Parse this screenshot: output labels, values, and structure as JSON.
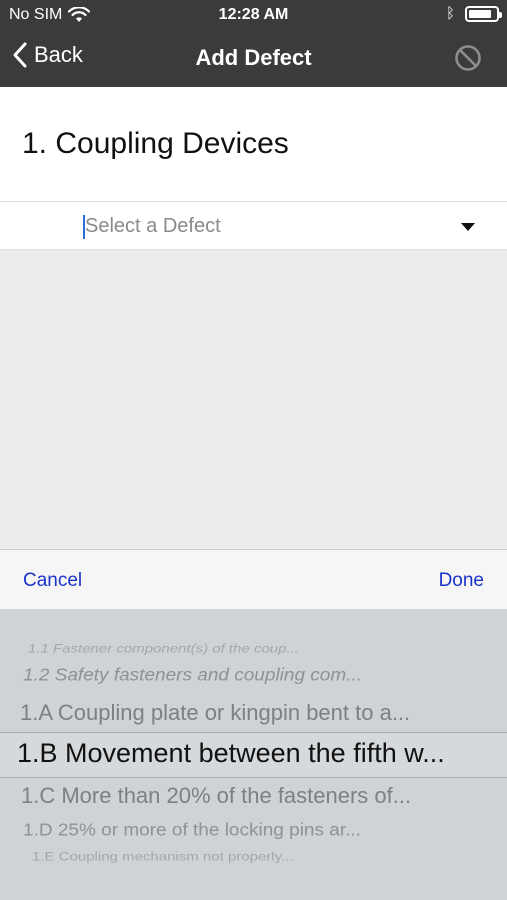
{
  "status_bar": {
    "carrier": "No SIM",
    "time": "12:28 AM",
    "battery_level": 0.85
  },
  "nav": {
    "back_label": "Back",
    "title": "Add Defect",
    "right_icon": "block-icon"
  },
  "section": {
    "heading": "1. Coupling Devices"
  },
  "defect_select": {
    "placeholder": "Select a Defect",
    "icon": "dropdown-caret-icon"
  },
  "picker_toolbar": {
    "cancel_label": "Cancel",
    "done_label": "Done",
    "accent_color": "#1a33c8"
  },
  "picker": {
    "options": [
      "1.1 Fastener component(s) of the coup...",
      "1.2 Safety fasteners and coupling com...",
      "1.A Coupling plate or kingpin bent to a...",
      "1.B Movement between the fifth w...",
      "1.C More than 20% of the fasteners of...",
      "1.D 25% or more of the locking pins ar...",
      "1.E Coupling mechanism not properly..."
    ],
    "selected_index": 3
  }
}
